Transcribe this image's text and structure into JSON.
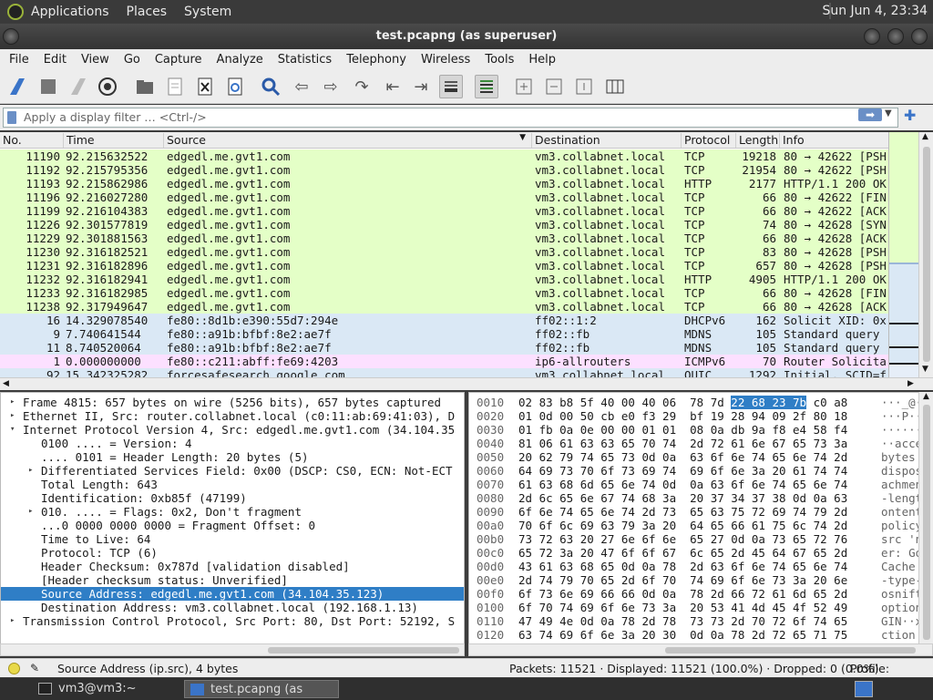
{
  "top_panel": {
    "menus": [
      "Applications",
      "Places",
      "System"
    ],
    "clock": "Sun Jun  4, 23:34"
  },
  "window": {
    "title": "test.pcapng (as superuser)"
  },
  "menubar": [
    "File",
    "Edit",
    "View",
    "Go",
    "Capture",
    "Analyze",
    "Statistics",
    "Telephony",
    "Wireless",
    "Tools",
    "Help"
  ],
  "filter": {
    "placeholder": "Apply a display filter … <Ctrl-/>"
  },
  "packet_list": {
    "columns": [
      "No.",
      "Time",
      "Source",
      "Destination",
      "Protocol",
      "Length",
      "Info"
    ],
    "rows": [
      {
        "no": "11190",
        "time": "92.215632522",
        "src": "edgedl.me.gvt1.com",
        "dst": "vm3.collabnet.local",
        "proto": "TCP",
        "len": "19218",
        "info": "80 → 42622 [PSH",
        "bg": "#e4ffc7"
      },
      {
        "no": "11192",
        "time": "92.215795356",
        "src": "edgedl.me.gvt1.com",
        "dst": "vm3.collabnet.local",
        "proto": "TCP",
        "len": "21954",
        "info": "80 → 42622 [PSH",
        "bg": "#e4ffc7"
      },
      {
        "no": "11193",
        "time": "92.215862986",
        "src": "edgedl.me.gvt1.com",
        "dst": "vm3.collabnet.local",
        "proto": "HTTP",
        "len": "2177",
        "info": "HTTP/1.1 200 OK",
        "bg": "#e4ffc7"
      },
      {
        "no": "11196",
        "time": "92.216027280",
        "src": "edgedl.me.gvt1.com",
        "dst": "vm3.collabnet.local",
        "proto": "TCP",
        "len": "66",
        "info": "80 → 42622 [FIN",
        "bg": "#e4ffc7"
      },
      {
        "no": "11199",
        "time": "92.216104383",
        "src": "edgedl.me.gvt1.com",
        "dst": "vm3.collabnet.local",
        "proto": "TCP",
        "len": "66",
        "info": "80 → 42622 [ACK",
        "bg": "#e4ffc7"
      },
      {
        "no": "11226",
        "time": "92.301577819",
        "src": "edgedl.me.gvt1.com",
        "dst": "vm3.collabnet.local",
        "proto": "TCP",
        "len": "74",
        "info": "80 → 42628 [SYN",
        "bg": "#e4ffc7"
      },
      {
        "no": "11229",
        "time": "92.301881563",
        "src": "edgedl.me.gvt1.com",
        "dst": "vm3.collabnet.local",
        "proto": "TCP",
        "len": "66",
        "info": "80 → 42628 [ACK",
        "bg": "#e4ffc7"
      },
      {
        "no": "11230",
        "time": "92.316182521",
        "src": "edgedl.me.gvt1.com",
        "dst": "vm3.collabnet.local",
        "proto": "TCP",
        "len": "83",
        "info": "80 → 42628 [PSH",
        "bg": "#e4ffc7"
      },
      {
        "no": "11231",
        "time": "92.316182896",
        "src": "edgedl.me.gvt1.com",
        "dst": "vm3.collabnet.local",
        "proto": "TCP",
        "len": "657",
        "info": "80 → 42628 [PSH",
        "bg": "#e4ffc7"
      },
      {
        "no": "11232",
        "time": "92.316182941",
        "src": "edgedl.me.gvt1.com",
        "dst": "vm3.collabnet.local",
        "proto": "HTTP",
        "len": "4905",
        "info": "HTTP/1.1 200 OK",
        "bg": "#e4ffc7"
      },
      {
        "no": "11233",
        "time": "92.316182985",
        "src": "edgedl.me.gvt1.com",
        "dst": "vm3.collabnet.local",
        "proto": "TCP",
        "len": "66",
        "info": "80 → 42628 [FIN",
        "bg": "#e4ffc7"
      },
      {
        "no": "11238",
        "time": "92.317949647",
        "src": "edgedl.me.gvt1.com",
        "dst": "vm3.collabnet.local",
        "proto": "TCP",
        "len": "66",
        "info": "80 → 42628 [ACK",
        "bg": "#e4ffc7"
      },
      {
        "no": "16",
        "time": "14.329078540",
        "src": "fe80::8d1b:e390:55d7:294e",
        "dst": "ff02::1:2",
        "proto": "DHCPv6",
        "len": "162",
        "info": "Solicit XID: 0x",
        "bg": "#dae8f5"
      },
      {
        "no": "9",
        "time": "7.740641544",
        "src": "fe80::a91b:bfbf:8e2:ae7f",
        "dst": "ff02::fb",
        "proto": "MDNS",
        "len": "105",
        "info": "Standard query",
        "bg": "#dae8f5"
      },
      {
        "no": "11",
        "time": "8.740520064",
        "src": "fe80::a91b:bfbf:8e2:ae7f",
        "dst": "ff02::fb",
        "proto": "MDNS",
        "len": "105",
        "info": "Standard query",
        "bg": "#dae8f5"
      },
      {
        "no": "1",
        "time": "0.000000000",
        "src": "fe80::c211:abff:fe69:4203",
        "dst": "ip6-allrouters",
        "proto": "ICMPv6",
        "len": "70",
        "info": "Router Solicita",
        "bg": "#fce0ff"
      },
      {
        "no": "92",
        "time": "15.342325282",
        "src": "forcesafesearch.google.com",
        "dst": "vm3.collabnet.local",
        "proto": "QUIC",
        "len": "1292",
        "info": "Initial, SCID=f",
        "bg": "#dae8f5"
      }
    ]
  },
  "details": {
    "rows": [
      {
        "text": "Frame 4815: 657 bytes on wire (5256 bits), 657 bytes captured",
        "level": 0,
        "tw": "▸"
      },
      {
        "text": "Ethernet II, Src: router.collabnet.local (c0:11:ab:69:41:03), D",
        "level": 0,
        "tw": "▸"
      },
      {
        "text": "Internet Protocol Version 4, Src: edgedl.me.gvt1.com (34.104.35",
        "level": 0,
        "tw": "▾"
      },
      {
        "text": "0100 .... = Version: 4",
        "level": 1,
        "tw": ""
      },
      {
        "text": ".... 0101 = Header Length: 20 bytes (5)",
        "level": 1,
        "tw": ""
      },
      {
        "text": "Differentiated Services Field: 0x00 (DSCP: CS0, ECN: Not-ECT",
        "level": 1,
        "tw": "▸"
      },
      {
        "text": "Total Length: 643",
        "level": 1,
        "tw": ""
      },
      {
        "text": "Identification: 0xb85f (47199)",
        "level": 1,
        "tw": ""
      },
      {
        "text": "010. .... = Flags: 0x2, Don't fragment",
        "level": 1,
        "tw": "▸"
      },
      {
        "text": "...0 0000 0000 0000 = Fragment Offset: 0",
        "level": 1,
        "tw": ""
      },
      {
        "text": "Time to Live: 64",
        "level": 1,
        "tw": ""
      },
      {
        "text": "Protocol: TCP (6)",
        "level": 1,
        "tw": ""
      },
      {
        "text": "Header Checksum: 0x787d [validation disabled]",
        "level": 1,
        "tw": ""
      },
      {
        "text": "[Header checksum status: Unverified]",
        "level": 1,
        "tw": ""
      },
      {
        "text": "Source Address: edgedl.me.gvt1.com (34.104.35.123)",
        "level": 1,
        "tw": "",
        "selected": true
      },
      {
        "text": "Destination Address: vm3.collabnet.local (192.168.1.13)",
        "level": 1,
        "tw": ""
      },
      {
        "text": "Transmission Control Protocol, Src Port: 80, Dst Port: 52192, S",
        "level": 0,
        "tw": "▸"
      }
    ]
  },
  "bytes": {
    "rows": [
      {
        "off": "0010",
        "pre": "02 83 b8 5f 40 00 40 06  78 7d ",
        "hl": "22 68 23 7b",
        "post": " c0 a8",
        "asc": "···_@·@·"
      },
      {
        "off": "0020",
        "pre": "01 0d 00 50 cb e0 f3 29  bf 19 28 94 09 2f 80 18",
        "hl": "",
        "post": "",
        "asc": "···P···)"
      },
      {
        "off": "0030",
        "pre": "01 fb 0a 0e 00 00 01 01  08 0a db 9a f8 e4 58 f4",
        "hl": "",
        "post": "",
        "asc": "········"
      },
      {
        "off": "0040",
        "pre": "81 06 61 63 63 65 70 74  2d 72 61 6e 67 65 73 3a",
        "hl": "",
        "post": "",
        "asc": "··acce"
      },
      {
        "off": "0050",
        "pre": "20 62 79 74 65 73 0d 0a  63 6f 6e 74 65 6e 74 2d",
        "hl": "",
        "post": "",
        "asc": " bytes"
      },
      {
        "off": "0060",
        "pre": "64 69 73 70 6f 73 69 74  69 6f 6e 3a 20 61 74 74",
        "hl": "",
        "post": "",
        "asc": "dispos"
      },
      {
        "off": "0070",
        "pre": "61 63 68 6d 65 6e 74 0d  0a 63 6f 6e 74 65 6e 74",
        "hl": "",
        "post": "",
        "asc": "achmen"
      },
      {
        "off": "0080",
        "pre": "2d 6c 65 6e 67 74 68 3a  20 37 34 37 38 0d 0a 63",
        "hl": "",
        "post": "",
        "asc": "-lengt"
      },
      {
        "off": "0090",
        "pre": "6f 6e 74 65 6e 74 2d 73  65 63 75 72 69 74 79 2d",
        "hl": "",
        "post": "",
        "asc": "ontent"
      },
      {
        "off": "00a0",
        "pre": "70 6f 6c 69 63 79 3a 20  64 65 66 61 75 6c 74 2d",
        "hl": "",
        "post": "",
        "asc": "policy"
      },
      {
        "off": "00b0",
        "pre": "73 72 63 20 27 6e 6f 6e  65 27 0d 0a 73 65 72 76",
        "hl": "",
        "post": "",
        "asc": "src 'n"
      },
      {
        "off": "00c0",
        "pre": "65 72 3a 20 47 6f 6f 67  6c 65 2d 45 64 67 65 2d",
        "hl": "",
        "post": "",
        "asc": "er: Go"
      },
      {
        "off": "00d0",
        "pre": "43 61 63 68 65 0d 0a 78  2d 63 6f 6e 74 65 6e 74",
        "hl": "",
        "post": "",
        "asc": "Cache"
      },
      {
        "off": "00e0",
        "pre": "2d 74 79 70 65 2d 6f 70  74 69 6f 6e 73 3a 20 6e",
        "hl": "",
        "post": "",
        "asc": "-type-"
      },
      {
        "off": "00f0",
        "pre": "6f 73 6e 69 66 66 0d 0a  78 2d 66 72 61 6d 65 2d",
        "hl": "",
        "post": "",
        "asc": "osnift"
      },
      {
        "off": "0100",
        "pre": "6f 70 74 69 6f 6e 73 3a  20 53 41 4d 45 4f 52 49",
        "hl": "",
        "post": "",
        "asc": "option"
      },
      {
        "off": "0110",
        "pre": "47 49 4e 0d 0a 78 2d 78  73 73 2d 70 72 6f 74 65",
        "hl": "",
        "post": "",
        "asc": "GIN··x"
      },
      {
        "off": "0120",
        "pre": "63 74 69 6f 6e 3a 20 30  0d 0a 78 2d 72 65 71 75",
        "hl": "",
        "post": "",
        "asc": "ction"
      }
    ]
  },
  "statusbar": {
    "field": "Source Address (ip.src), 4 bytes",
    "counts": "Packets: 11521 · Displayed: 11521 (100.0%) · Dropped: 0 (0.0%)",
    "profile": "Profile: Default"
  },
  "taskbar": {
    "tasks": [
      "vm3@vm3:~",
      "test.pcapng (as supe..."
    ]
  },
  "colors": {
    "tcp_row": "#e4ffc7",
    "udp_row": "#dae8f5",
    "icmp_row": "#fce0ff",
    "selection": "#2f7ec6"
  }
}
